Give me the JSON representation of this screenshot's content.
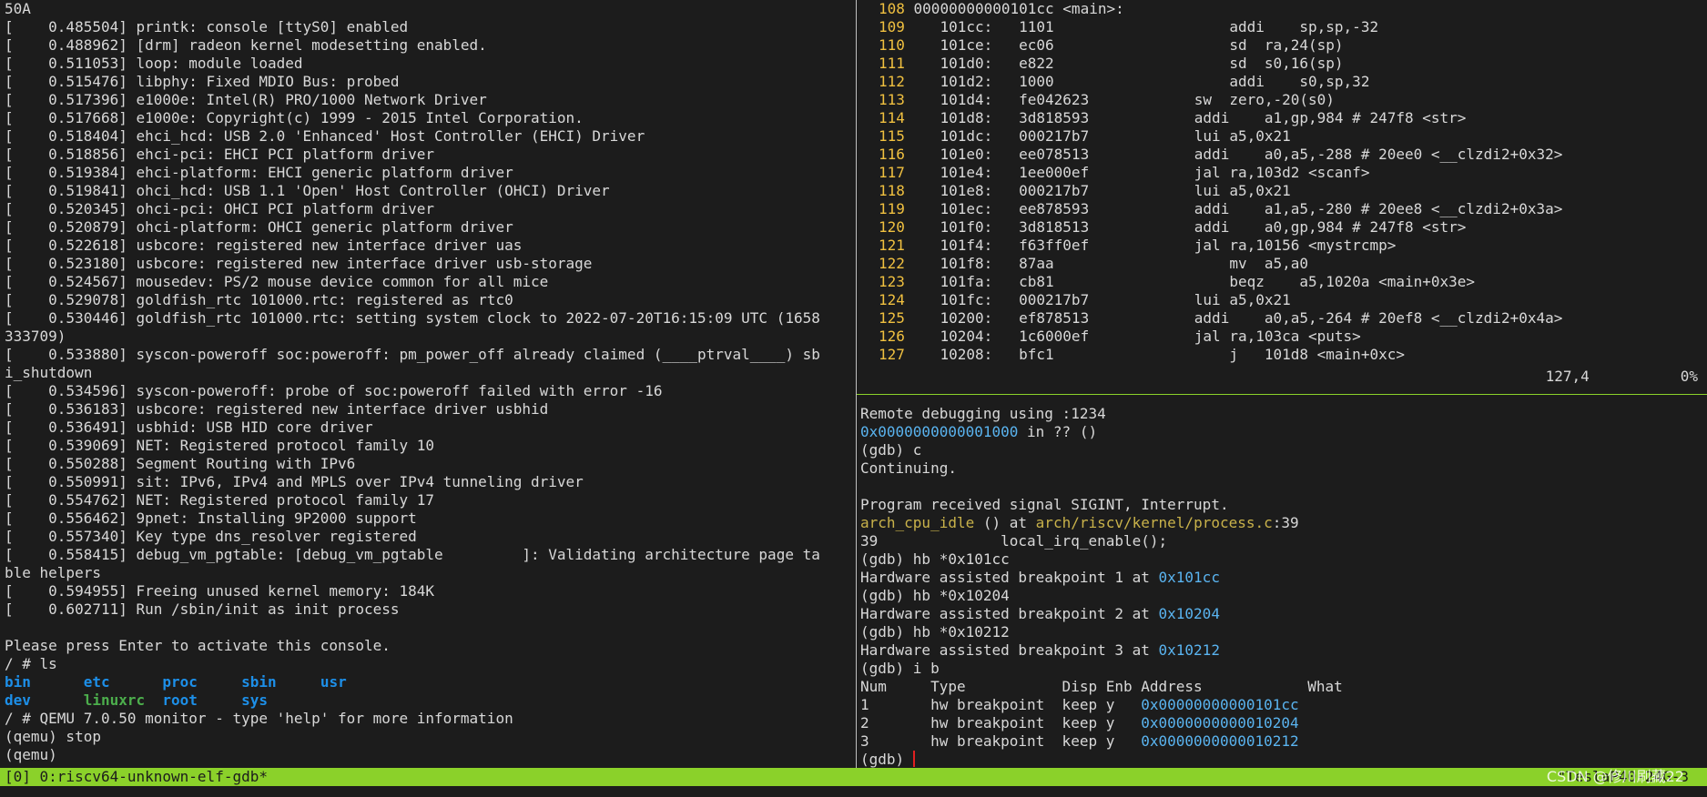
{
  "left_pane": {
    "lines": [
      "50A",
      "[    0.485504] printk: console [ttyS0] enabled",
      "[    0.488962] [drm] radeon kernel modesetting enabled.",
      "[    0.511053] loop: module loaded",
      "[    0.515476] libphy: Fixed MDIO Bus: probed",
      "[    0.517396] e1000e: Intel(R) PRO/1000 Network Driver",
      "[    0.517668] e1000e: Copyright(c) 1999 - 2015 Intel Corporation.",
      "[    0.518404] ehci_hcd: USB 2.0 'Enhanced' Host Controller (EHCI) Driver",
      "[    0.518856] ehci-pci: EHCI PCI platform driver",
      "[    0.519384] ehci-platform: EHCI generic platform driver",
      "[    0.519841] ohci_hcd: USB 1.1 'Open' Host Controller (OHCI) Driver",
      "[    0.520345] ohci-pci: OHCI PCI platform driver",
      "[    0.520879] ohci-platform: OHCI generic platform driver",
      "[    0.522618] usbcore: registered new interface driver uas",
      "[    0.523180] usbcore: registered new interface driver usb-storage",
      "[    0.524567] mousedev: PS/2 mouse device common for all mice",
      "[    0.529078] goldfish_rtc 101000.rtc: registered as rtc0",
      "[    0.530446] goldfish_rtc 101000.rtc: setting system clock to 2022-07-20T16:15:09 UTC (1658",
      "333709)",
      "[    0.533880] syscon-poweroff soc:poweroff: pm_power_off already claimed (____ptrval____) sb",
      "i_shutdown",
      "[    0.534596] syscon-poweroff: probe of soc:poweroff failed with error -16",
      "[    0.536183] usbcore: registered new interface driver usbhid",
      "[    0.536491] usbhid: USB HID core driver",
      "[    0.539069] NET: Registered protocol family 10",
      "[    0.550288] Segment Routing with IPv6",
      "[    0.550991] sit: IPv6, IPv4 and MPLS over IPv4 tunneling driver",
      "[    0.554762] NET: Registered protocol family 17",
      "[    0.556462] 9pnet: Installing 9P2000 support",
      "[    0.557340] Key type dns_resolver registered",
      "[    0.558415] debug_vm_pgtable: [debug_vm_pgtable         ]: Validating architecture page ta",
      "ble helpers",
      "[    0.594955] Freeing unused kernel memory: 184K",
      "[    0.602711] Run /sbin/init as init process",
      "",
      "Please press Enter to activate this console.",
      "/ # ls"
    ],
    "ls_row1": {
      "d1": "bin",
      "d2": "etc",
      "d3": "proc",
      "d4": "sbin",
      "d5": "usr"
    },
    "ls_row2": {
      "d1": "dev",
      "f1": "linuxrc",
      "d2": "root",
      "d3": "sys"
    },
    "tail_lines": [
      "/ # QEMU 7.0.50 monitor - type 'help' for more information",
      "(qemu) stop",
      "(qemu)"
    ]
  },
  "disassembly": {
    "lines": [
      {
        "ln": "108",
        "text": " 00000000000101cc <main>:"
      },
      {
        "ln": "109",
        "text": "    101cc:   1101                    addi    sp,sp,-32"
      },
      {
        "ln": "110",
        "text": "    101ce:   ec06                    sd  ra,24(sp)"
      },
      {
        "ln": "111",
        "text": "    101d0:   e822                    sd  s0,16(sp)"
      },
      {
        "ln": "112",
        "text": "    101d2:   1000                    addi    s0,sp,32"
      },
      {
        "ln": "113",
        "text": "    101d4:   fe042623            sw  zero,-20(s0)"
      },
      {
        "ln": "114",
        "text": "    101d8:   3d818593            addi    a1,gp,984 # 247f8 <str>"
      },
      {
        "ln": "115",
        "text": "    101dc:   000217b7            lui a5,0x21"
      },
      {
        "ln": "116",
        "text": "    101e0:   ee078513            addi    a0,a5,-288 # 20ee0 <__clzdi2+0x32>"
      },
      {
        "ln": "117",
        "text": "    101e4:   1ee000ef            jal ra,103d2 <scanf>"
      },
      {
        "ln": "118",
        "text": "    101e8:   000217b7            lui a5,0x21"
      },
      {
        "ln": "119",
        "text": "    101ec:   ee878593            addi    a1,a5,-280 # 20ee8 <__clzdi2+0x3a>"
      },
      {
        "ln": "120",
        "text": "    101f0:   3d818513            addi    a0,gp,984 # 247f8 <str>"
      },
      {
        "ln": "121",
        "text": "    101f4:   f63ff0ef            jal ra,10156 <mystrcmp>"
      },
      {
        "ln": "122",
        "text": "    101f8:   87aa                    mv  a5,a0"
      },
      {
        "ln": "123",
        "text": "    101fa:   cb81                    beqz    a5,1020a <main+0x3e>"
      },
      {
        "ln": "124",
        "text": "    101fc:   000217b7            lui a5,0x21"
      },
      {
        "ln": "125",
        "text": "    10200:   ef878513            addi    a0,a5,-264 # 20ef8 <__clzdi2+0x4a>"
      },
      {
        "ln": "126",
        "text": "    10204:   1c6000ef            jal ra,103ca <puts>"
      },
      {
        "ln": "127",
        "text": "    10208:   bfc1                    j   101d8 <main+0xc>"
      }
    ],
    "ruler_pos": "127,4",
    "ruler_pct": "0%"
  },
  "gdb": {
    "l1": "Remote debugging using :1234",
    "l2_addr": "0x0000000000001000",
    "l2_rest": " in ?? ()",
    "l3": "(gdb) c",
    "l4": "Continuing.",
    "l5": "",
    "l6": "Program received signal SIGINT, Interrupt.",
    "l7_func": "arch_cpu_idle",
    "l7_mid": " () at ",
    "l7_file": "arch/riscv/kernel/process.c",
    "l7_line": ":39",
    "l8": "39              local_irq_enable();",
    "l9": "(gdb) hb *0x101cc",
    "l10_text": "Hardware assisted breakpoint 1 at ",
    "l10_addr": "0x101cc",
    "l11": "(gdb) hb *0x10204",
    "l12_text": "Hardware assisted breakpoint 2 at ",
    "l12_addr": "0x10204",
    "l13": "(gdb) hb *0x10212",
    "l14_text": "Hardware assisted breakpoint 3 at ",
    "l14_addr": "0x10212",
    "l15": "(gdb) i b",
    "table_header": "Num     Type           Disp Enb Address            What",
    "bp1_pre": "1       hw breakpoint  keep y   ",
    "bp1_addr": "0x00000000000101cc",
    "bp2_pre": "2       hw breakpoint  keep y   ",
    "bp2_addr": "0x0000000000010204",
    "bp3_pre": "3       hw breakpoint  keep y   ",
    "bp3_addr": "0x0000000000010212",
    "prompt": "(gdb) "
  },
  "status_bar": {
    "left": "[0] 0:riscv64-unknown-elf-gdb*",
    "right": "\"TeslaP40-24G-3"
  },
  "watermark": "CSDN @修川刷藏22",
  "colors": {
    "background": "#1c1c1c",
    "status_bar": "#8bd12a",
    "line_number": "#f0c040",
    "address": "#5ab4f0",
    "directory": "#1d8fe8",
    "executable": "#4cae4c",
    "cursor": "#e02020"
  }
}
